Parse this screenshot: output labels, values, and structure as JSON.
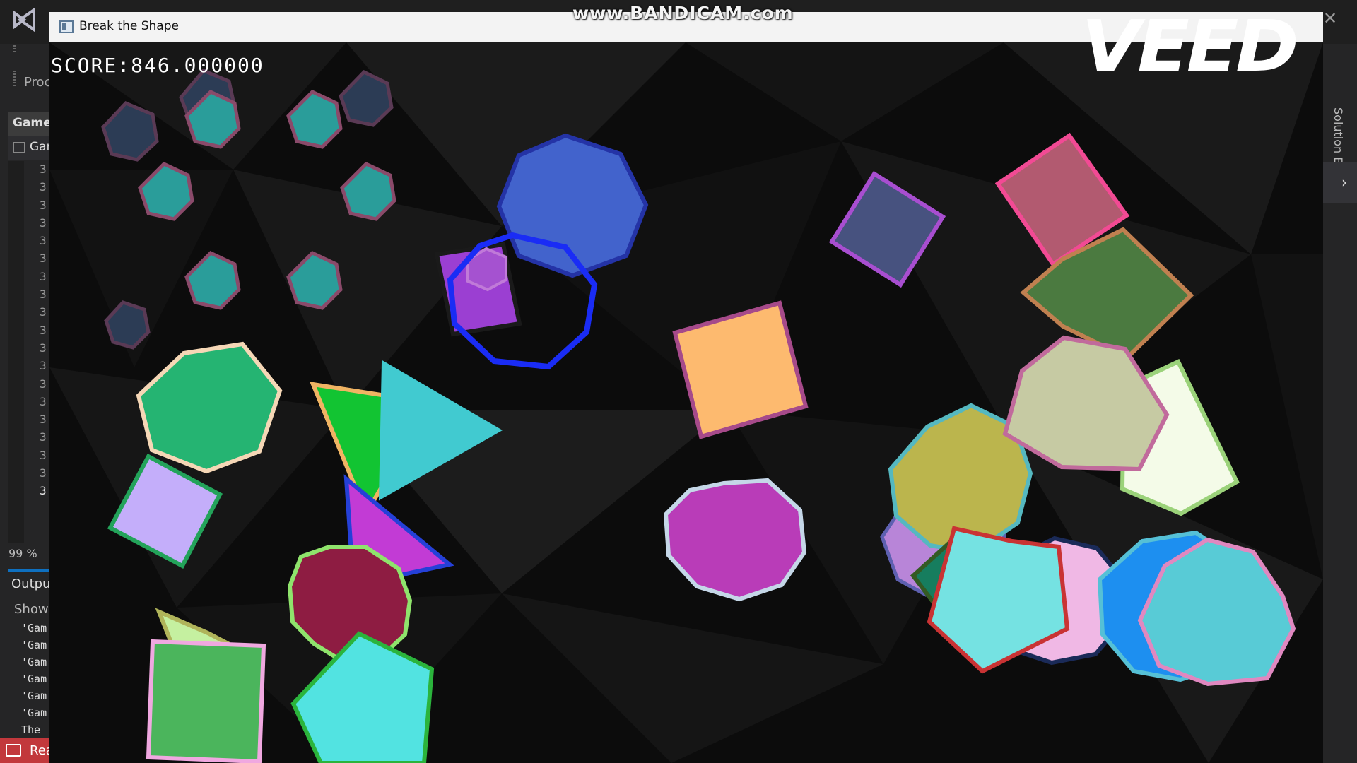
{
  "ide": {
    "process_label": "Proc",
    "panel_header": "Gamec",
    "file_tab": "Gam",
    "line_number_digit": "3",
    "zoom": "99 %",
    "output_title": "Output",
    "output_show_label": "Show",
    "output_lines": [
      "'Gam",
      "'Gam",
      "'Gam",
      "'Gam",
      "'Gam",
      "'Gam",
      "The"
    ],
    "status_text": "Rea",
    "solution_label": "Solution E"
  },
  "window": {
    "title": "Break the Shape"
  },
  "game": {
    "score_label": "SCORE",
    "score_value": "846.000000"
  },
  "watermarks": {
    "bandicam": "www.BANDICAM.com",
    "veed": "VEED"
  },
  "colors": {
    "ide_status_bar": "#c2383c",
    "ide_accent": "#0e70c0",
    "game_background": "#0c0c0c"
  },
  "icons": [
    "visual-studio-logo-icon",
    "window-app-icon",
    "close-icon",
    "chat-icon",
    "chevron-right-icon"
  ]
}
